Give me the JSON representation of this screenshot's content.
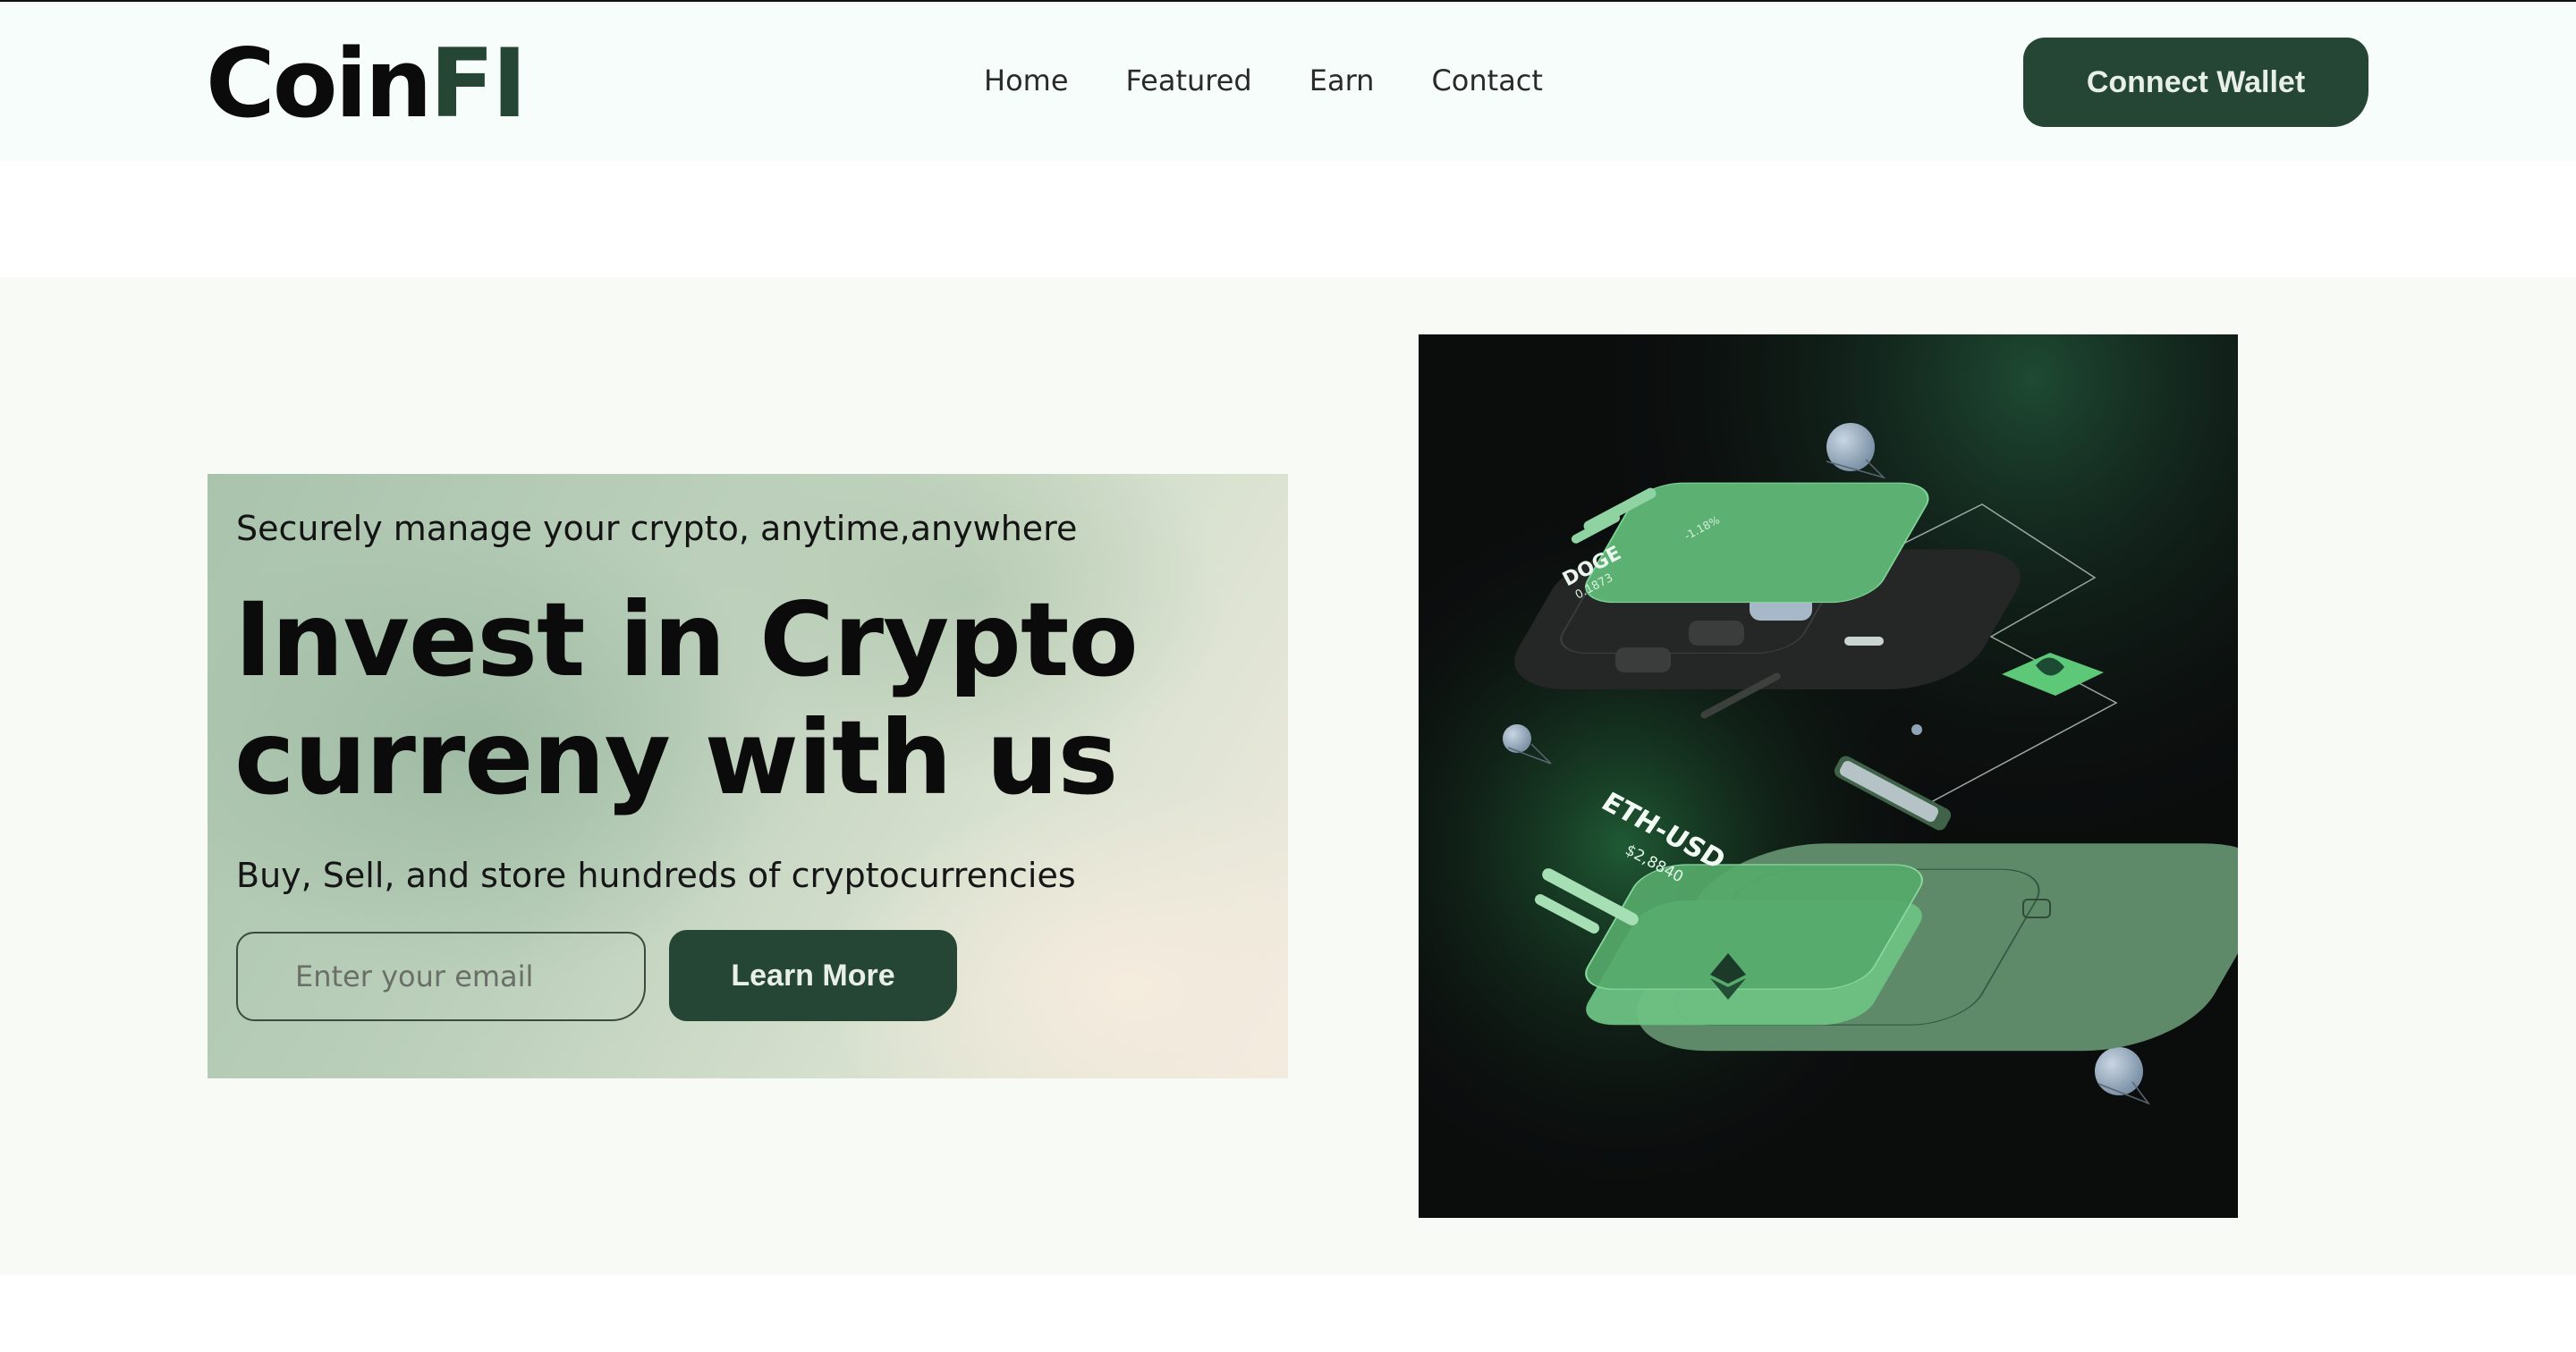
{
  "header": {
    "logo_main": "Coin",
    "logo_accent": "FI",
    "nav": [
      "Home",
      "Featured",
      "Earn",
      "Contact"
    ],
    "cta": "Connect Wallet"
  },
  "hero": {
    "tagline": "Securely manage your crypto, anytime,anywhere",
    "headline_line1": "Invest in Crypto",
    "headline_line2": "curreny with us",
    "subline": "Buy, Sell, and store hundreds of cryptocurrencies",
    "email_placeholder": "Enter your email",
    "learn_more": "Learn More"
  },
  "illustration": {
    "doge_name": "DOGE",
    "doge_value": "0.1873",
    "doge_change": "-1.18%",
    "eth_name": "ETH-USD",
    "eth_value": "$2,8840"
  },
  "colors": {
    "brand_dark_green": "#254634",
    "header_bg": "#f6fdfa",
    "hero_bg": "#f8faf5",
    "accent_green": "#5dc878"
  }
}
